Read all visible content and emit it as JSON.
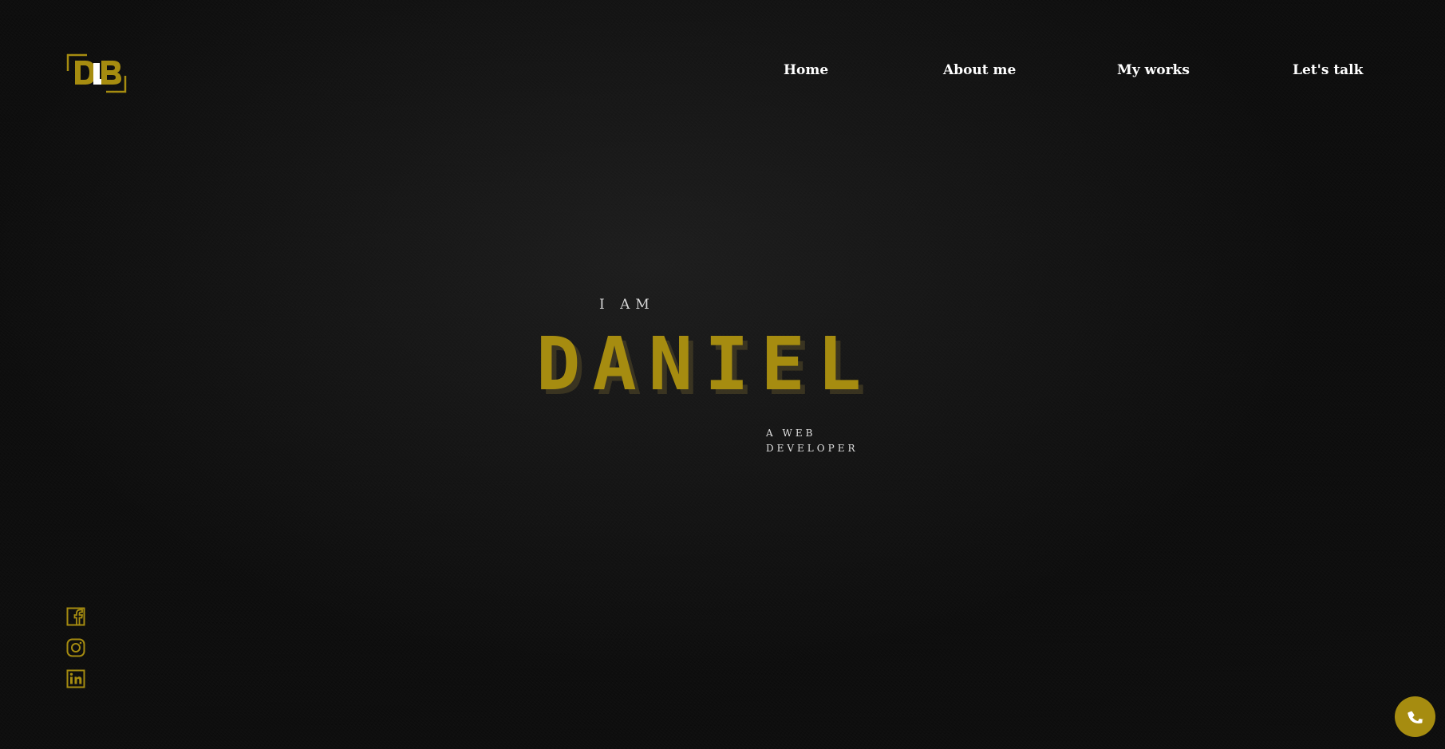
{
  "brand": {
    "logo_icon": "db-monogram-logo",
    "accent_color": "#a68c10"
  },
  "nav": {
    "items": [
      {
        "label": "Home"
      },
      {
        "label": "About me"
      },
      {
        "label": "My works"
      },
      {
        "label": "Let's talk"
      }
    ]
  },
  "hero": {
    "intro": "I AM",
    "name": "DANIEL",
    "role_line1": "A WEB",
    "role_line2": "DEVELOPER"
  },
  "social": {
    "icons": [
      "facebook-icon",
      "instagram-icon",
      "linkedin-icon"
    ]
  },
  "contact_button": {
    "icon": "phone-icon"
  }
}
